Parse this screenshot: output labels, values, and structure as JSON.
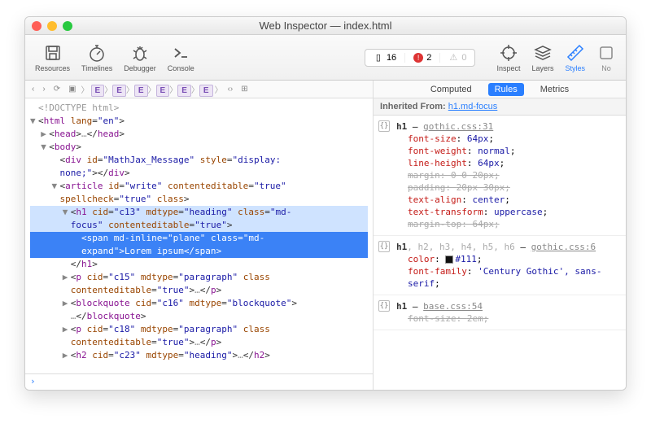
{
  "window": {
    "title": "Web Inspector — index.html"
  },
  "toolbar": {
    "resources": "Resources",
    "timelines": "Timelines",
    "debugger": "Debugger",
    "console": "Console",
    "inspect": "Inspect",
    "layers": "Layers",
    "styles": "Styles",
    "node": "No"
  },
  "counters": {
    "logs": "16",
    "errors": "2",
    "warnings": "0"
  },
  "breadcrumb": [
    "E",
    "E",
    "E",
    "E",
    "E",
    "E"
  ],
  "dom_lines": [
    {
      "indent": 0,
      "tri": "",
      "html": "<span class='d'>&lt;!DOCTYPE html&gt;</span>"
    },
    {
      "indent": 0,
      "tri": "▼",
      "html": "&lt;<span class='t'>html</span> <span class='a'>lang</span>=<span class='v'>\"en\"</span>&gt;"
    },
    {
      "indent": 1,
      "tri": "▶",
      "html": "&lt;<span class='t'>head</span>&gt;<span class='d'>…</span>&lt;/<span class='t'>head</span>&gt;"
    },
    {
      "indent": 1,
      "tri": "▼",
      "html": "&lt;<span class='t'>body</span>&gt;"
    },
    {
      "indent": 2,
      "tri": "",
      "html": "&lt;<span class='t'>div</span> <span class='a'>id</span>=<span class='v'>\"MathJax_Message\"</span> <span class='a'>style</span>=<span class='v'>\"display:</span>"
    },
    {
      "indent": 2,
      "tri": "",
      "html": "<span class='v'>none;\"</span>&gt;&lt;/<span class='t'>div</span>&gt;"
    },
    {
      "indent": 2,
      "tri": "▼",
      "html": "&lt;<span class='t'>article</span> <span class='a'>id</span>=<span class='v'>\"write\"</span> <span class='a'>contenteditable</span>=<span class='v'>\"true\"</span>"
    },
    {
      "indent": 2,
      "tri": "",
      "html": "<span class='a'>spellcheck</span>=<span class='v'>\"true\"</span> <span class='a'>class</span>&gt;"
    },
    {
      "indent": 3,
      "tri": "▼",
      "html": "&lt;<span class='t'>h1</span> <span class='a'>cid</span>=<span class='v'>\"c13\"</span> <span class='a'>mdtype</span>=<span class='v'>\"heading\"</span> <span class='a'>class</span>=<span class='v'>\"md-</span>",
      "cls": "hl2"
    },
    {
      "indent": 3,
      "tri": "",
      "html": "<span class='v'>focus\"</span> <span class='a'>contenteditable</span>=<span class='v'>\"true\"</span>&gt;",
      "cls": "hl2"
    },
    {
      "indent": 4,
      "tri": "",
      "html": "&lt;<span class='t'>span</span> <span class='a'>md-inline</span>=<span class='v'>\"plane\"</span> <span class='a'>class</span>=<span class='v'>\"md-</span>",
      "cls": "hl"
    },
    {
      "indent": 4,
      "tri": "",
      "html": "<span class='v'>expand\"</span>&gt;Lorem ipsum&lt;/<span class='t'>span</span>&gt;",
      "cls": "hl"
    },
    {
      "indent": 3,
      "tri": "",
      "html": "&lt;/<span class='t'>h1</span>&gt;"
    },
    {
      "indent": 3,
      "tri": "▶",
      "html": "&lt;<span class='t'>p</span> <span class='a'>cid</span>=<span class='v'>\"c15\"</span> <span class='a'>mdtype</span>=<span class='v'>\"paragraph\"</span> <span class='a'>class</span>"
    },
    {
      "indent": 3,
      "tri": "",
      "html": "<span class='a'>contenteditable</span>=<span class='v'>\"true\"</span>&gt;<span class='d'>…</span>&lt;/<span class='t'>p</span>&gt;"
    },
    {
      "indent": 3,
      "tri": "▶",
      "html": "&lt;<span class='t'>blockquote</span> <span class='a'>cid</span>=<span class='v'>\"c16\"</span> <span class='a'>mdtype</span>=<span class='v'>\"blockquote\"</span>&gt;"
    },
    {
      "indent": 3,
      "tri": "",
      "html": "<span class='d'>…</span>&lt;/<span class='t'>blockquote</span>&gt;"
    },
    {
      "indent": 3,
      "tri": "▶",
      "html": "&lt;<span class='t'>p</span> <span class='a'>cid</span>=<span class='v'>\"c18\"</span> <span class='a'>mdtype</span>=<span class='v'>\"paragraph\"</span> <span class='a'>class</span>"
    },
    {
      "indent": 3,
      "tri": "",
      "html": "<span class='a'>contenteditable</span>=<span class='v'>\"true\"</span>&gt;<span class='d'>…</span>&lt;/<span class='t'>p</span>&gt;"
    },
    {
      "indent": 3,
      "tri": "▶",
      "html": "&lt;<span class='t'>h2</span> <span class='a'>cid</span>=<span class='v'>\"c23\"</span> <span class='a'>mdtype</span>=<span class='v'>\"heading\"</span>&gt;<span class='d'>…</span>&lt;/<span class='t'>h2</span>&gt;"
    }
  ],
  "styles": {
    "tabs": {
      "computed": "Computed",
      "rules": "Rules",
      "metrics": "Metrics"
    },
    "inherited_label": "Inherited From:",
    "inherited_link": "h1.md-focus",
    "rules": [
      {
        "selector_main": "h1",
        "selector_dim": "",
        "source": "gothic.css:31",
        "props": [
          {
            "n": "font-size",
            "v": "64px",
            "strike": false
          },
          {
            "n": "font-weight",
            "v": "normal",
            "strike": false
          },
          {
            "n": "line-height",
            "v": "64px",
            "strike": false
          },
          {
            "n": "margin",
            "v": "0 0 20px",
            "strike": true
          },
          {
            "n": "padding",
            "v": "20px 30px",
            "strike": true
          },
          {
            "n": "text-align",
            "v": "center",
            "strike": false
          },
          {
            "n": "text-transform",
            "v": "uppercase",
            "strike": false
          },
          {
            "n": "margin-top",
            "v": "64px",
            "strike": true
          }
        ]
      },
      {
        "selector_main": "h1",
        "selector_dim": ", h2, h3, h4, h5, h6",
        "source": "gothic.css:6",
        "props": [
          {
            "n": "color",
            "v": "#111",
            "strike": false,
            "swatch": "#111"
          },
          {
            "n": "font-family",
            "v": "'Century Gothic', sans-serif",
            "strike": false
          }
        ]
      },
      {
        "selector_main": "h1",
        "selector_dim": "",
        "source": "base.css:54",
        "props": [
          {
            "n": "font-size",
            "v": "2em",
            "strike": true
          }
        ]
      }
    ]
  }
}
